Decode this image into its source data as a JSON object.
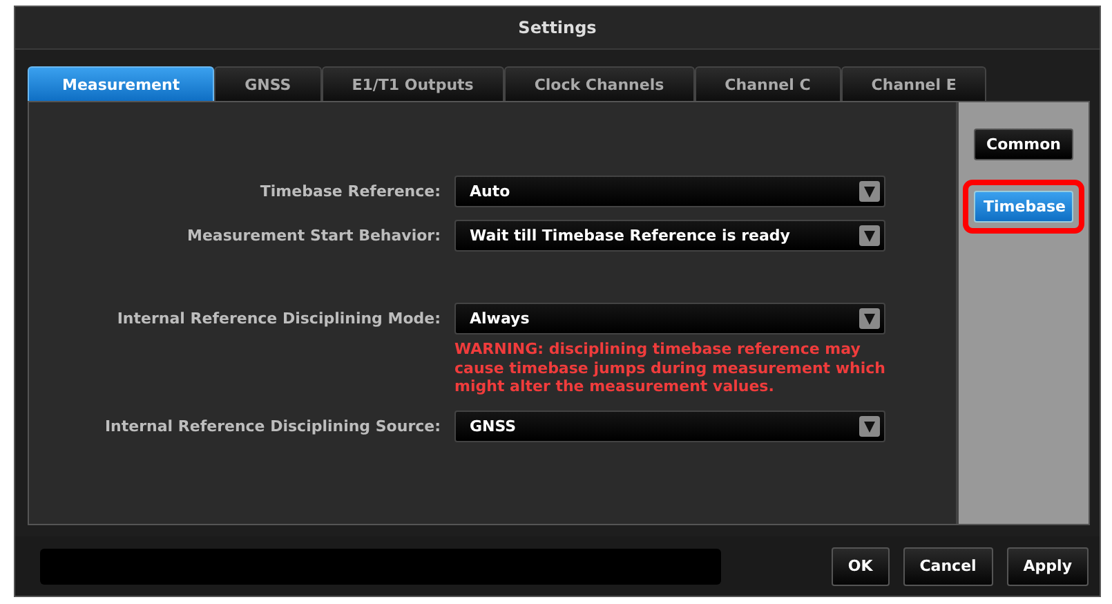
{
  "window": {
    "title": "Settings"
  },
  "tabs": [
    {
      "label": "Measurement",
      "selected": true
    },
    {
      "label": "GNSS",
      "selected": false
    },
    {
      "label": "E1/T1 Outputs",
      "selected": false
    },
    {
      "label": "Clock Channels",
      "selected": false
    },
    {
      "label": "Channel C",
      "selected": false
    },
    {
      "label": "Channel E",
      "selected": false
    }
  ],
  "field_groups": [
    [
      {
        "label": "Timebase Reference:",
        "value": "Auto"
      },
      {
        "label": "Measurement Start Behavior:",
        "value": "Wait till Timebase Reference is ready"
      }
    ],
    [
      {
        "label": "Internal Reference Disciplining Mode:",
        "value": "Always",
        "warning": "WARNING: disciplining timebase reference may cause timebase jumps during measurement which might alter the measurement values."
      },
      {
        "label": "Internal Reference Disciplining Source:",
        "value": "GNSS"
      }
    ]
  ],
  "side_buttons": [
    {
      "label": "Common",
      "selected": false,
      "highlighted": false
    },
    {
      "label": "Timebase",
      "selected": true,
      "highlighted": true
    }
  ],
  "buttons": [
    "OK",
    "Cancel",
    "Apply"
  ]
}
